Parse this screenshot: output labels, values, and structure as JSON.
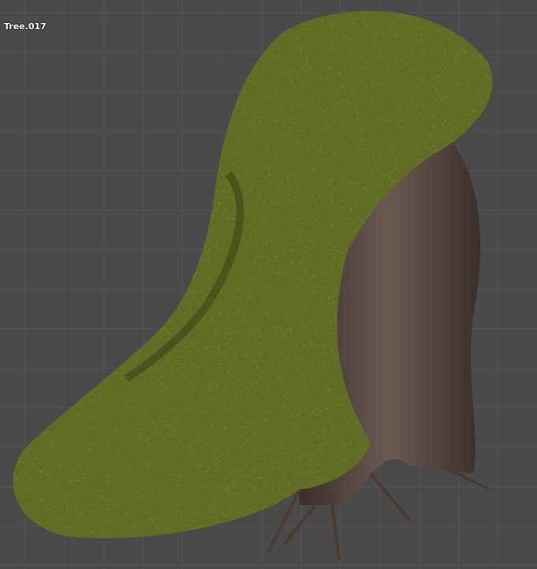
{
  "viewport": {
    "object_name": "Tree.017"
  },
  "colors": {
    "foliage": "#6b7a2a",
    "foliage_light": "#9aa23c",
    "trunk": "#4a3a33",
    "bark_light": "#8a7c72"
  }
}
